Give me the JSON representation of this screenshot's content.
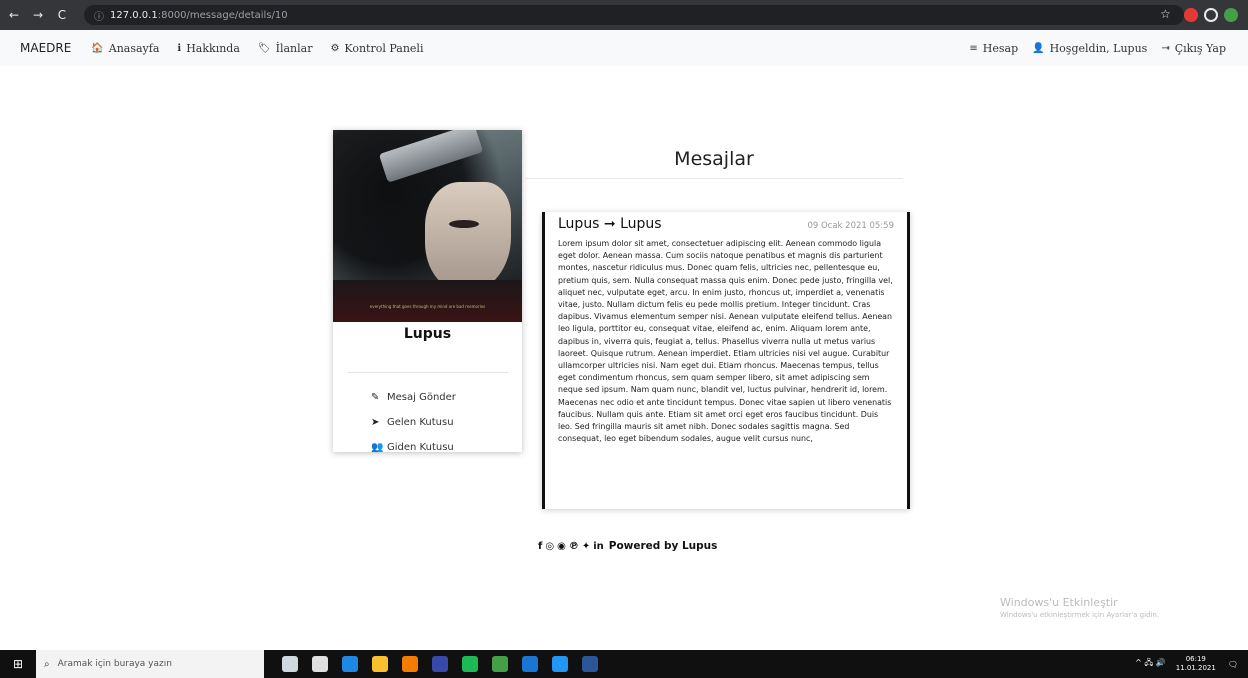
{
  "browser": {
    "back_icon": "←",
    "forward_icon": "→",
    "reload_icon": "C",
    "info_icon": "ⓘ",
    "url_host": "127.0.0.1",
    "url_path": ":8000/message/details/10",
    "star_icon": "☆"
  },
  "nav": {
    "brand": "MAEDRE",
    "items": [
      {
        "icon": "🏠",
        "label": "Anasayfa"
      },
      {
        "icon": "ℹ",
        "label": "Hakkında"
      },
      {
        "icon": "🏷",
        "label": "İlanlar"
      },
      {
        "icon": "⚙",
        "label": "Kontrol Paneli"
      }
    ],
    "right_items": [
      {
        "icon": "≡",
        "label": "Hesap"
      },
      {
        "icon": "👤",
        "label": "Hoşgeldin, Lupus"
      },
      {
        "icon": "⇥",
        "label": "Çıkış Yap"
      }
    ]
  },
  "profile": {
    "quote": "everything that goes through my mind are bad memories",
    "name": "Lupus",
    "menu": [
      {
        "icon": "✎",
        "label": "Mesaj Gönder"
      },
      {
        "icon": "➤",
        "label": "Gelen Kutusu"
      },
      {
        "icon": "👥",
        "label": "Giden Kutusu"
      }
    ]
  },
  "messages": {
    "heading": "Mesajlar",
    "item": {
      "sender": "Lupus ➞ Lupus",
      "date": "09 Ocak 2021 05:59",
      "body": "Lorem ipsum dolor sit amet, consectetuer adipiscing elit. Aenean commodo ligula eget dolor. Aenean massa. Cum sociis natoque penatibus et magnis dis parturient montes, nascetur ridiculus mus. Donec quam felis, ultricies nec, pellentesque eu, pretium quis, sem. Nulla consequat massa quis enim. Donec pede justo, fringilla vel, aliquet nec, vulputate eget, arcu. In enim justo, rhoncus ut, imperdiet a, venenatis vitae, justo. Nullam dictum felis eu pede mollis pretium. Integer tincidunt. Cras dapibus. Vivamus elementum semper nisi. Aenean vulputate eleifend tellus. Aenean leo ligula, porttitor eu, consequat vitae, eleifend ac, enim. Aliquam lorem ante, dapibus in, viverra quis, feugiat a, tellus. Phasellus viverra nulla ut metus varius laoreet. Quisque rutrum. Aenean imperdiet. Etiam ultricies nisi vel augue. Curabitur ullamcorper ultricies nisi. Nam eget dui. Etiam rhoncus. Maecenas tempus, tellus eget condimentum rhoncus, sem quam semper libero, sit amet adipiscing sem neque sed ipsum. Nam quam nunc, blandit vel, luctus pulvinar, hendrerit id, lorem. Maecenas nec odio et ante tincidunt tempus. Donec vitae sapien ut libero venenatis faucibus. Nullam quis ante. Etiam sit amet orci eget eros faucibus tincidunt. Duis leo. Sed fringilla mauris sit amet nibh. Donec sodales sagittis magna. Sed consequat, leo eget bibendum sodales, augue velit cursus nunc,"
    }
  },
  "footer": {
    "social": [
      "f",
      "◎",
      "◉",
      "℗",
      "✦",
      "in"
    ],
    "powered": "Powered by Lupus"
  },
  "windows_activation": {
    "title": "Windows'u Etkinleştir",
    "subtitle": "Windows'u etkinleştirmek için Ayarlar'a gidin."
  },
  "taskbar": {
    "start_icon": "⊞",
    "search_icon": "⌕",
    "search_placeholder": "Aramak için buraya yazın",
    "app_colors": [
      "#cfd8dc",
      "#e0e0e0",
      "#1e88e5",
      "#fbc02d",
      "#f57c00",
      "#3949ab",
      "#1db954",
      "#43a047",
      "#1976d2",
      "#2196f3",
      "#2b579a"
    ],
    "tray_icons": "^ 🖧 🔊",
    "time": "06:19",
    "date": "11.01.2021",
    "notify_icon": "🗨"
  },
  "colors": {
    "chrome_bg": "#35363a",
    "navbar_bg": "#f8f9fa",
    "taskbar_bg": "#101010"
  }
}
